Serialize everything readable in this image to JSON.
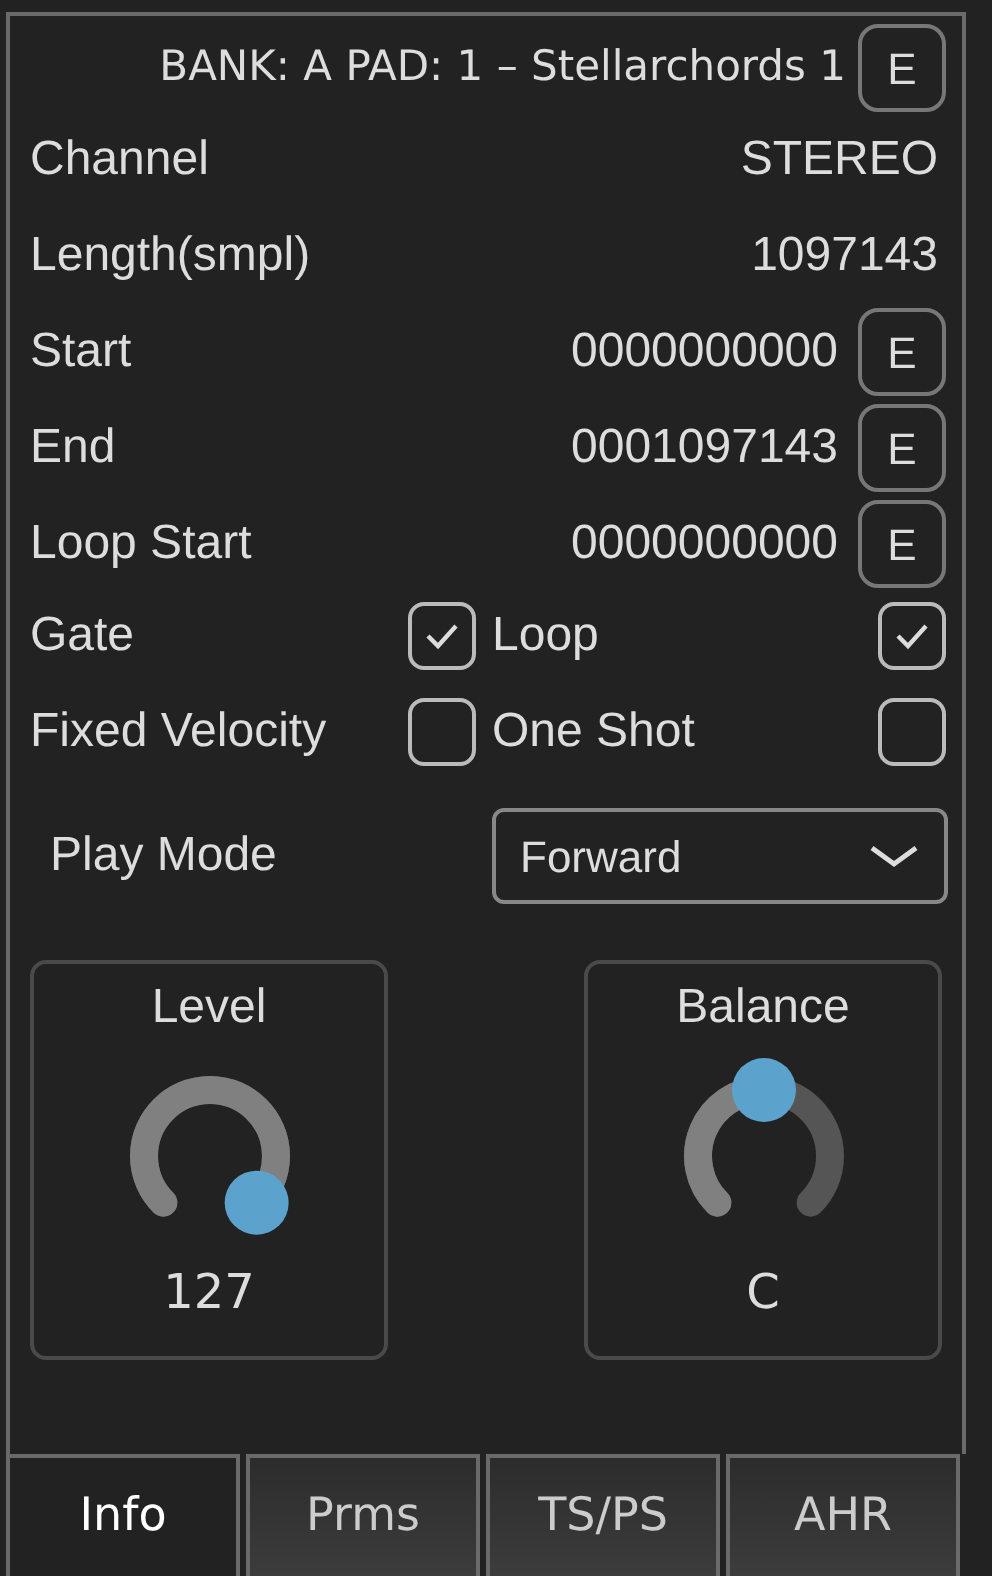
{
  "header": {
    "title": "BANK: A PAD: 1 – Stellarchords 1",
    "button": "E"
  },
  "fields": [
    {
      "kind": "value",
      "label": "Channel",
      "value": "STEREO"
    },
    {
      "kind": "value",
      "label": "Length(smpl)",
      "value": "1097143"
    },
    {
      "kind": "edit",
      "label": "Start",
      "value": "0000000000",
      "button": "E"
    },
    {
      "kind": "edit",
      "label": "End",
      "value": "0001097143",
      "button": "E"
    },
    {
      "kind": "edit",
      "label": "Loop Start",
      "value": "0000000000",
      "button": "E"
    }
  ],
  "checkboxes": [
    {
      "label": "Gate",
      "checked": true
    },
    {
      "label": "Loop",
      "checked": true
    },
    {
      "label": "Fixed Velocity",
      "checked": false
    },
    {
      "label": "One Shot",
      "checked": false
    }
  ],
  "play_mode": {
    "label": "Play Mode",
    "value": "Forward"
  },
  "knobs": [
    {
      "label": "Level",
      "level": 1,
      "reading": "127"
    },
    {
      "label": "Balance",
      "level": 0.5,
      "reading": "C"
    }
  ],
  "tabs": [
    {
      "label": "Info",
      "selected": true
    },
    {
      "label": "Prms",
      "selected": false
    },
    {
      "label": "TS/PS",
      "selected": false
    },
    {
      "label": "AHR",
      "selected": false
    }
  ]
}
